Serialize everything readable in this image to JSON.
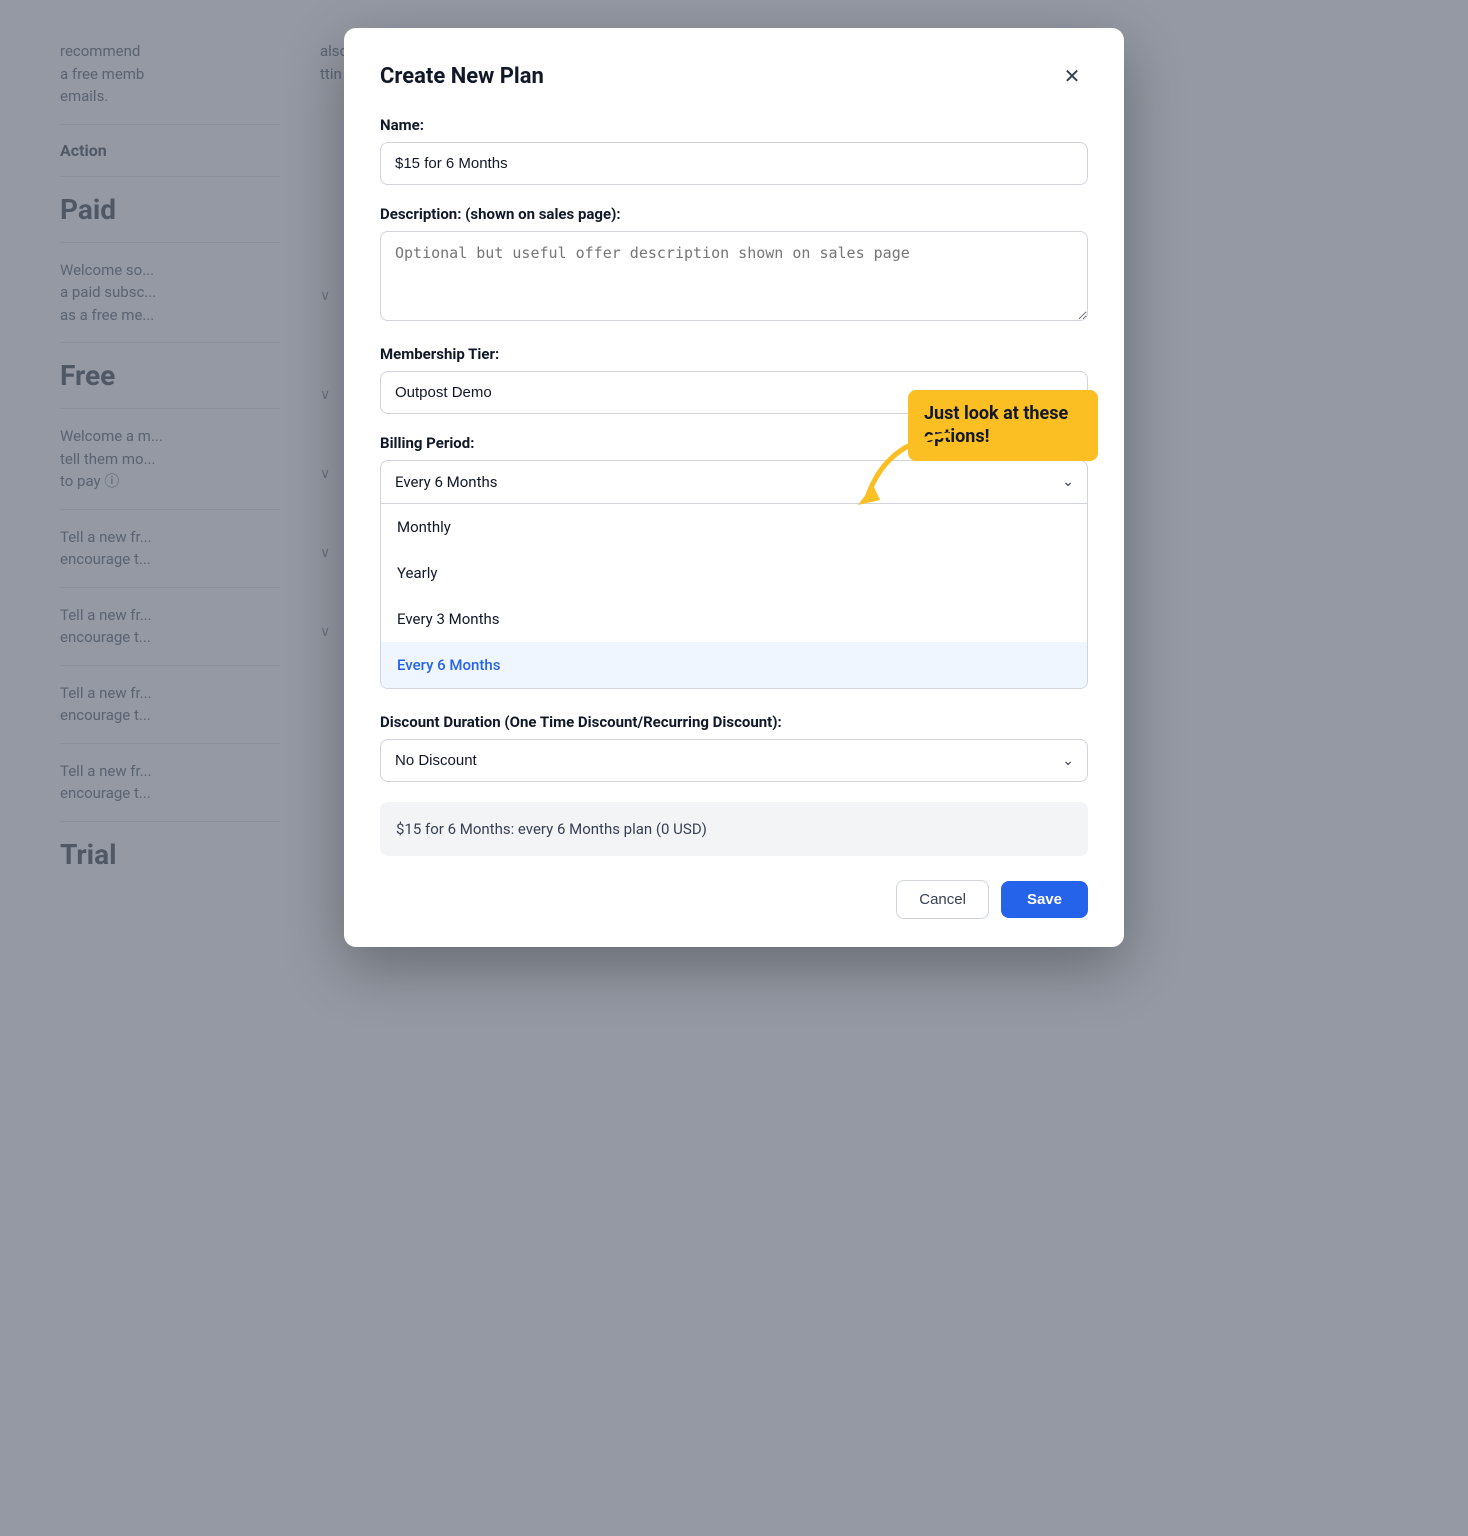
{
  "background": {
    "sections": [
      {
        "title": "Action",
        "type": "label"
      },
      {
        "title": "Paid",
        "type": "section",
        "text": "Welcome so... a paid subsc... as a free me..."
      },
      {
        "title": "Free",
        "type": "section",
        "text": "Welcome a m... tell them mo... to pay"
      },
      {
        "title": "Trial",
        "type": "section",
        "text": ""
      }
    ],
    "bg_text_top": "recommend ... also",
    "bg_text_top2": "a free memb... ttin",
    "bg_text_top3": "emails."
  },
  "modal": {
    "title": "Create New Plan",
    "close_label": "×",
    "fields": {
      "name_label": "Name:",
      "name_value": "$15 for 6 Months",
      "description_label": "Description: (shown on sales page):",
      "description_placeholder": "Optional but useful offer description shown on sales page",
      "membership_tier_label": "Membership Tier:",
      "membership_tier_value": "Outpost Demo",
      "billing_period_label": "Billing Period:",
      "billing_period_value": "Every 6 Months",
      "discount_label": "Discount Duration (One Time Discount/Recurring Discount):",
      "discount_value": "No Discount"
    },
    "billing_options": [
      {
        "label": "Monthly",
        "selected": false
      },
      {
        "label": "Yearly",
        "selected": false
      },
      {
        "label": "Every 3 Months",
        "selected": false
      },
      {
        "label": "Every 6 Months",
        "selected": true
      }
    ],
    "annotation": {
      "text": "Just look at these options!",
      "bg_color": "#fbbf24"
    },
    "summary": "$15 for 6 Months: every 6 Months plan (0 USD)",
    "footer": {
      "cancel_label": "Cancel",
      "save_label": "Save"
    }
  }
}
